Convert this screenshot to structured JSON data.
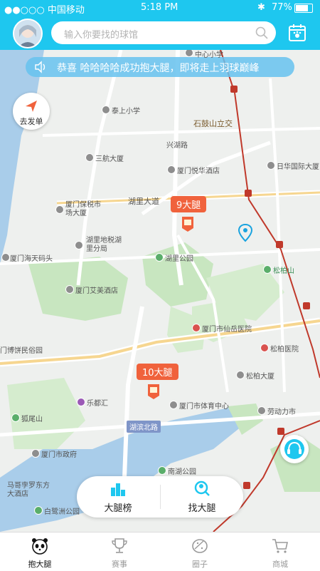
{
  "status": {
    "carrier": "●●○○○ 中国移动",
    "time": "5:18 PM",
    "battery": "77%"
  },
  "search": {
    "placeholder": "输入你要找的球馆"
  },
  "notice": {
    "text": "恭喜 哈哈哈哈成功抱大腿，即将走上羽球巅峰"
  },
  "fab": {
    "label": "去发单"
  },
  "map_labels": [
    "中心小学",
    "泰上小学",
    "石鼓山立交",
    "兴湖路",
    "三航大厦",
    "厦门悦华酒店",
    "日华国际大厦",
    "湖里大道",
    "厦门保税市场大厦",
    "湖里地税湖里分局",
    "厦门海天码头",
    "湖里公园",
    "松柏山",
    "厦门艾美酒店",
    "厦门市仙岳医院",
    "门博饼民俗园",
    "松柏医院",
    "松柏大厦",
    "乐都汇",
    "厦门市体育中心",
    "劳动力市",
    "狐尾山",
    "湖滨北路",
    "厦门市政府",
    "南湖公园",
    "马哥孛罗东方大酒店",
    "白鹭洲公园"
  ],
  "markers": [
    {
      "label": "9大腿"
    },
    {
      "label": "10大腿"
    }
  ],
  "panel": {
    "rank_label": "大腿榜",
    "find_label": "找大腿"
  },
  "tabs": [
    {
      "label": "抱大腿"
    },
    {
      "label": "赛事"
    },
    {
      "label": "圈子"
    },
    {
      "label": "商城"
    }
  ],
  "colors": {
    "header": "#1ec7ef",
    "marker": "#f0623c",
    "metro": "#c0392b",
    "accent": "#1aa3df"
  }
}
